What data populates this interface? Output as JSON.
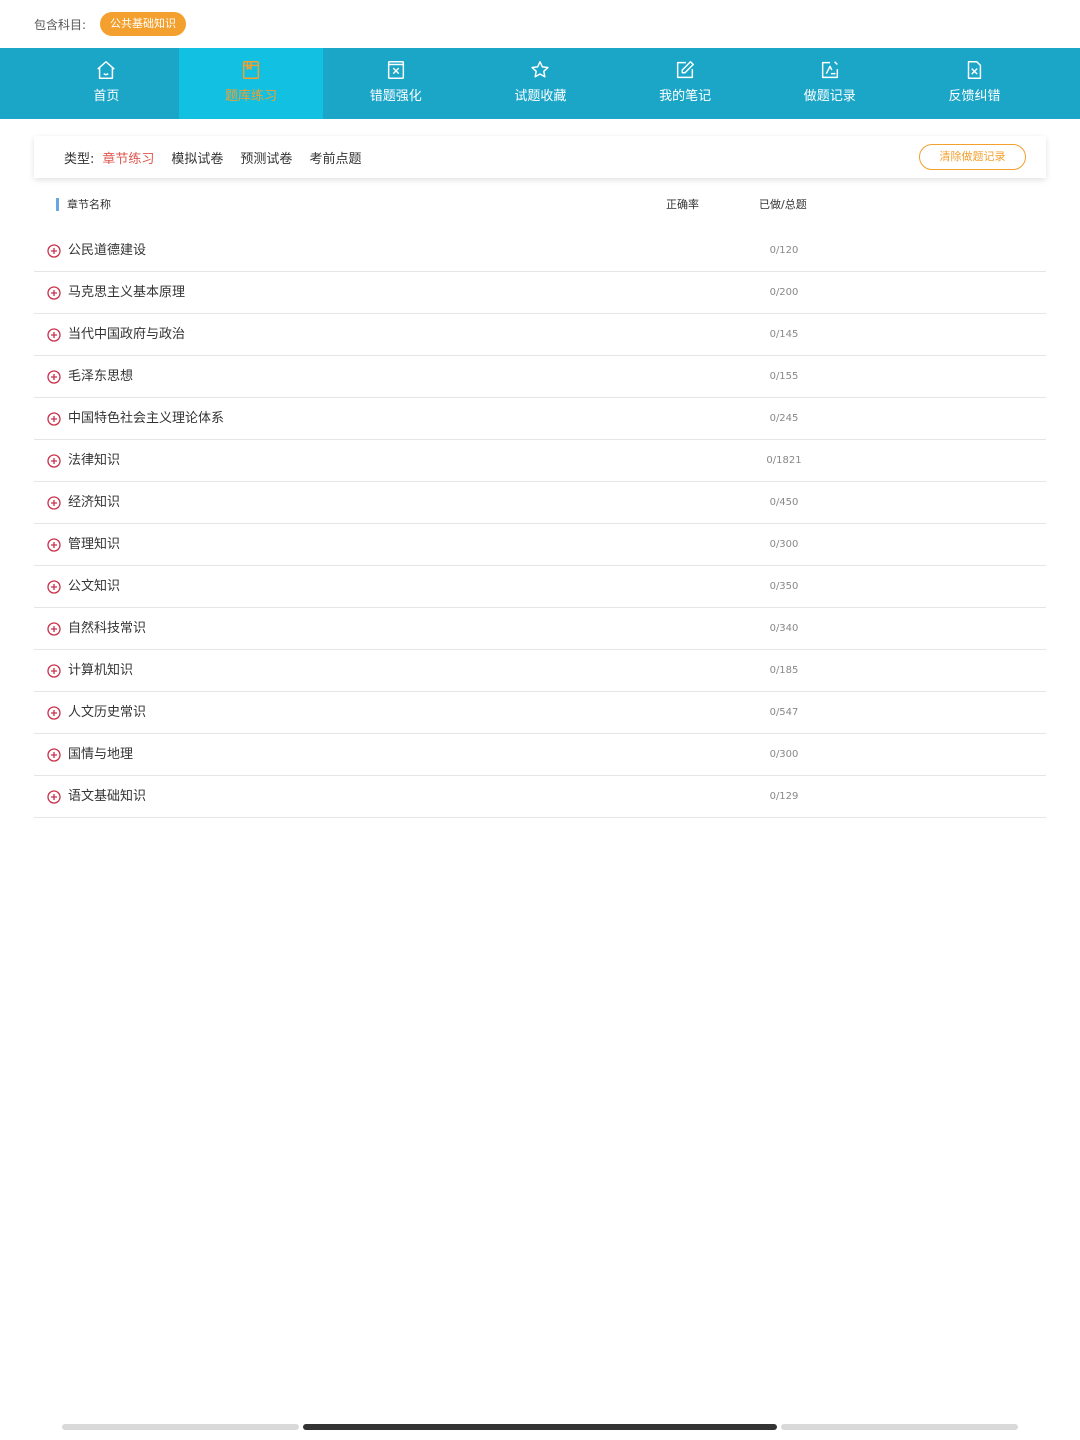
{
  "subject": {
    "label": "包含科目:",
    "chip": "公共基础知识"
  },
  "nav": {
    "tabs": [
      {
        "label": "首页",
        "icon": "home-icon"
      },
      {
        "label": "题库练习",
        "icon": "question-bank-icon",
        "active": true
      },
      {
        "label": "错题强化",
        "icon": "wrong-question-icon"
      },
      {
        "label": "试题收藏",
        "icon": "star-icon"
      },
      {
        "label": "我的笔记",
        "icon": "note-edit-icon"
      },
      {
        "label": "做题记录",
        "icon": "record-icon"
      },
      {
        "label": "反馈纠错",
        "icon": "feedback-icon"
      }
    ],
    "colors": {
      "bar": "#1ba6c8",
      "active_bg": "#12c0e2",
      "active_text": "#f3a02e"
    }
  },
  "filter": {
    "label": "类型:",
    "items": [
      "章节练习",
      "模拟试卷",
      "预测试卷",
      "考前点题"
    ],
    "active_index": 0,
    "clear_button": "清除做题记录"
  },
  "table": {
    "headers": {
      "name": "章节名称",
      "accuracy": "正确率",
      "done_total": "已做/总题"
    },
    "rows": [
      {
        "name": "公民道德建设",
        "accuracy": "",
        "count": "0/120"
      },
      {
        "name": "马克思主义基本原理",
        "accuracy": "",
        "count": "0/200"
      },
      {
        "name": "当代中国政府与政治",
        "accuracy": "",
        "count": "0/145"
      },
      {
        "name": "毛泽东思想",
        "accuracy": "",
        "count": "0/155"
      },
      {
        "name": "中国特色社会主义理论体系",
        "accuracy": "",
        "count": "0/245"
      },
      {
        "name": "法律知识",
        "accuracy": "",
        "count": "0/1821"
      },
      {
        "name": "经济知识",
        "accuracy": "",
        "count": "0/450"
      },
      {
        "name": "管理知识",
        "accuracy": "",
        "count": "0/300"
      },
      {
        "name": "公文知识",
        "accuracy": "",
        "count": "0/350"
      },
      {
        "name": "自然科技常识",
        "accuracy": "",
        "count": "0/340"
      },
      {
        "name": "计算机知识",
        "accuracy": "",
        "count": "0/185"
      },
      {
        "name": "人文历史常识",
        "accuracy": "",
        "count": "0/547"
      },
      {
        "name": "国情与地理",
        "accuracy": "",
        "count": "0/300"
      },
      {
        "name": "语文基础知识",
        "accuracy": "",
        "count": "0/129"
      }
    ]
  },
  "colors": {
    "accent_orange": "#f3a02e",
    "active_red": "#e0574f",
    "expand_icon": "#c9304a"
  }
}
